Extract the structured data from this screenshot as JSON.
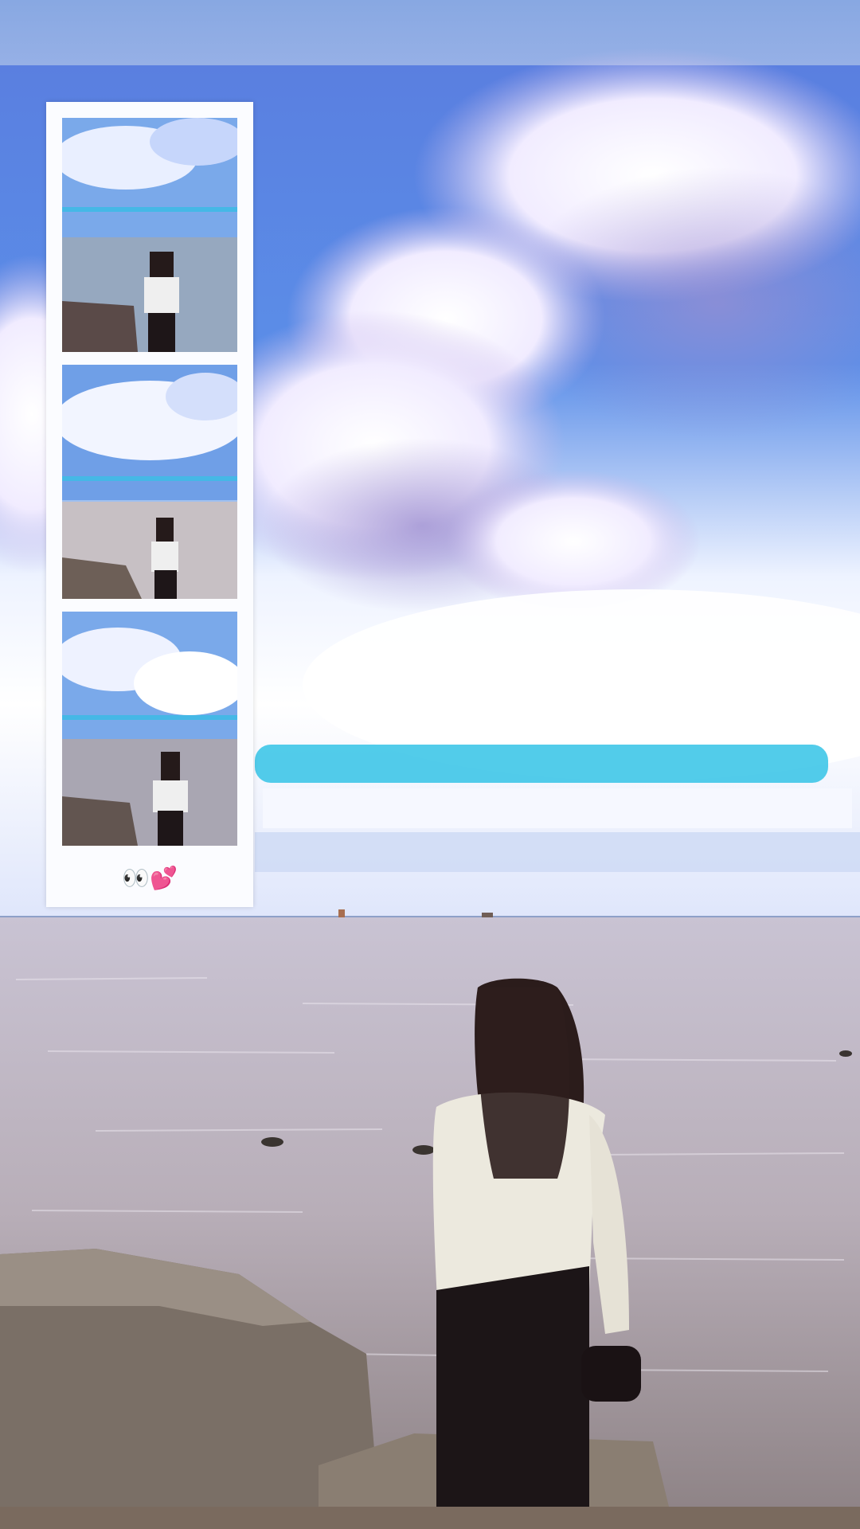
{
  "story": {
    "photo_strip": {
      "frame_count": 3,
      "caption": "👀💕"
    }
  }
}
